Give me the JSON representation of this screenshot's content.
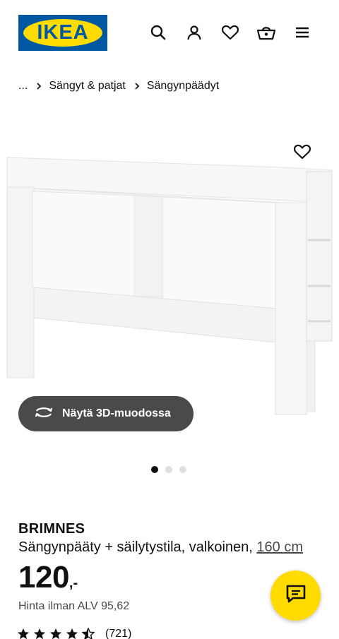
{
  "header": {
    "logo_text": "IKEA",
    "icons": [
      "search-icon",
      "account-icon",
      "heart-icon",
      "basket-icon",
      "menu-icon"
    ]
  },
  "breadcrumb": {
    "ellipsis": "...",
    "items": [
      "Sängyt & patjat",
      "Sängynpäädyt"
    ]
  },
  "gallery": {
    "view_3d_label": "Näytä 3D-muodossa",
    "slides": 3,
    "active_slide": 1
  },
  "product": {
    "name": "BRIMNES",
    "description": "Sängynpääty + säilytystila, valkoinen,",
    "size": "160 cm",
    "price": "120",
    "price_suffix": ",-",
    "vat_text": "Hinta ilman ALV 95,62",
    "rating_value": 4.5,
    "rating_count": "(721)"
  },
  "colors": {
    "brand_blue": "#0058a3",
    "brand_yellow": "#ffdb00",
    "button_dark": "#4a4a4a"
  }
}
